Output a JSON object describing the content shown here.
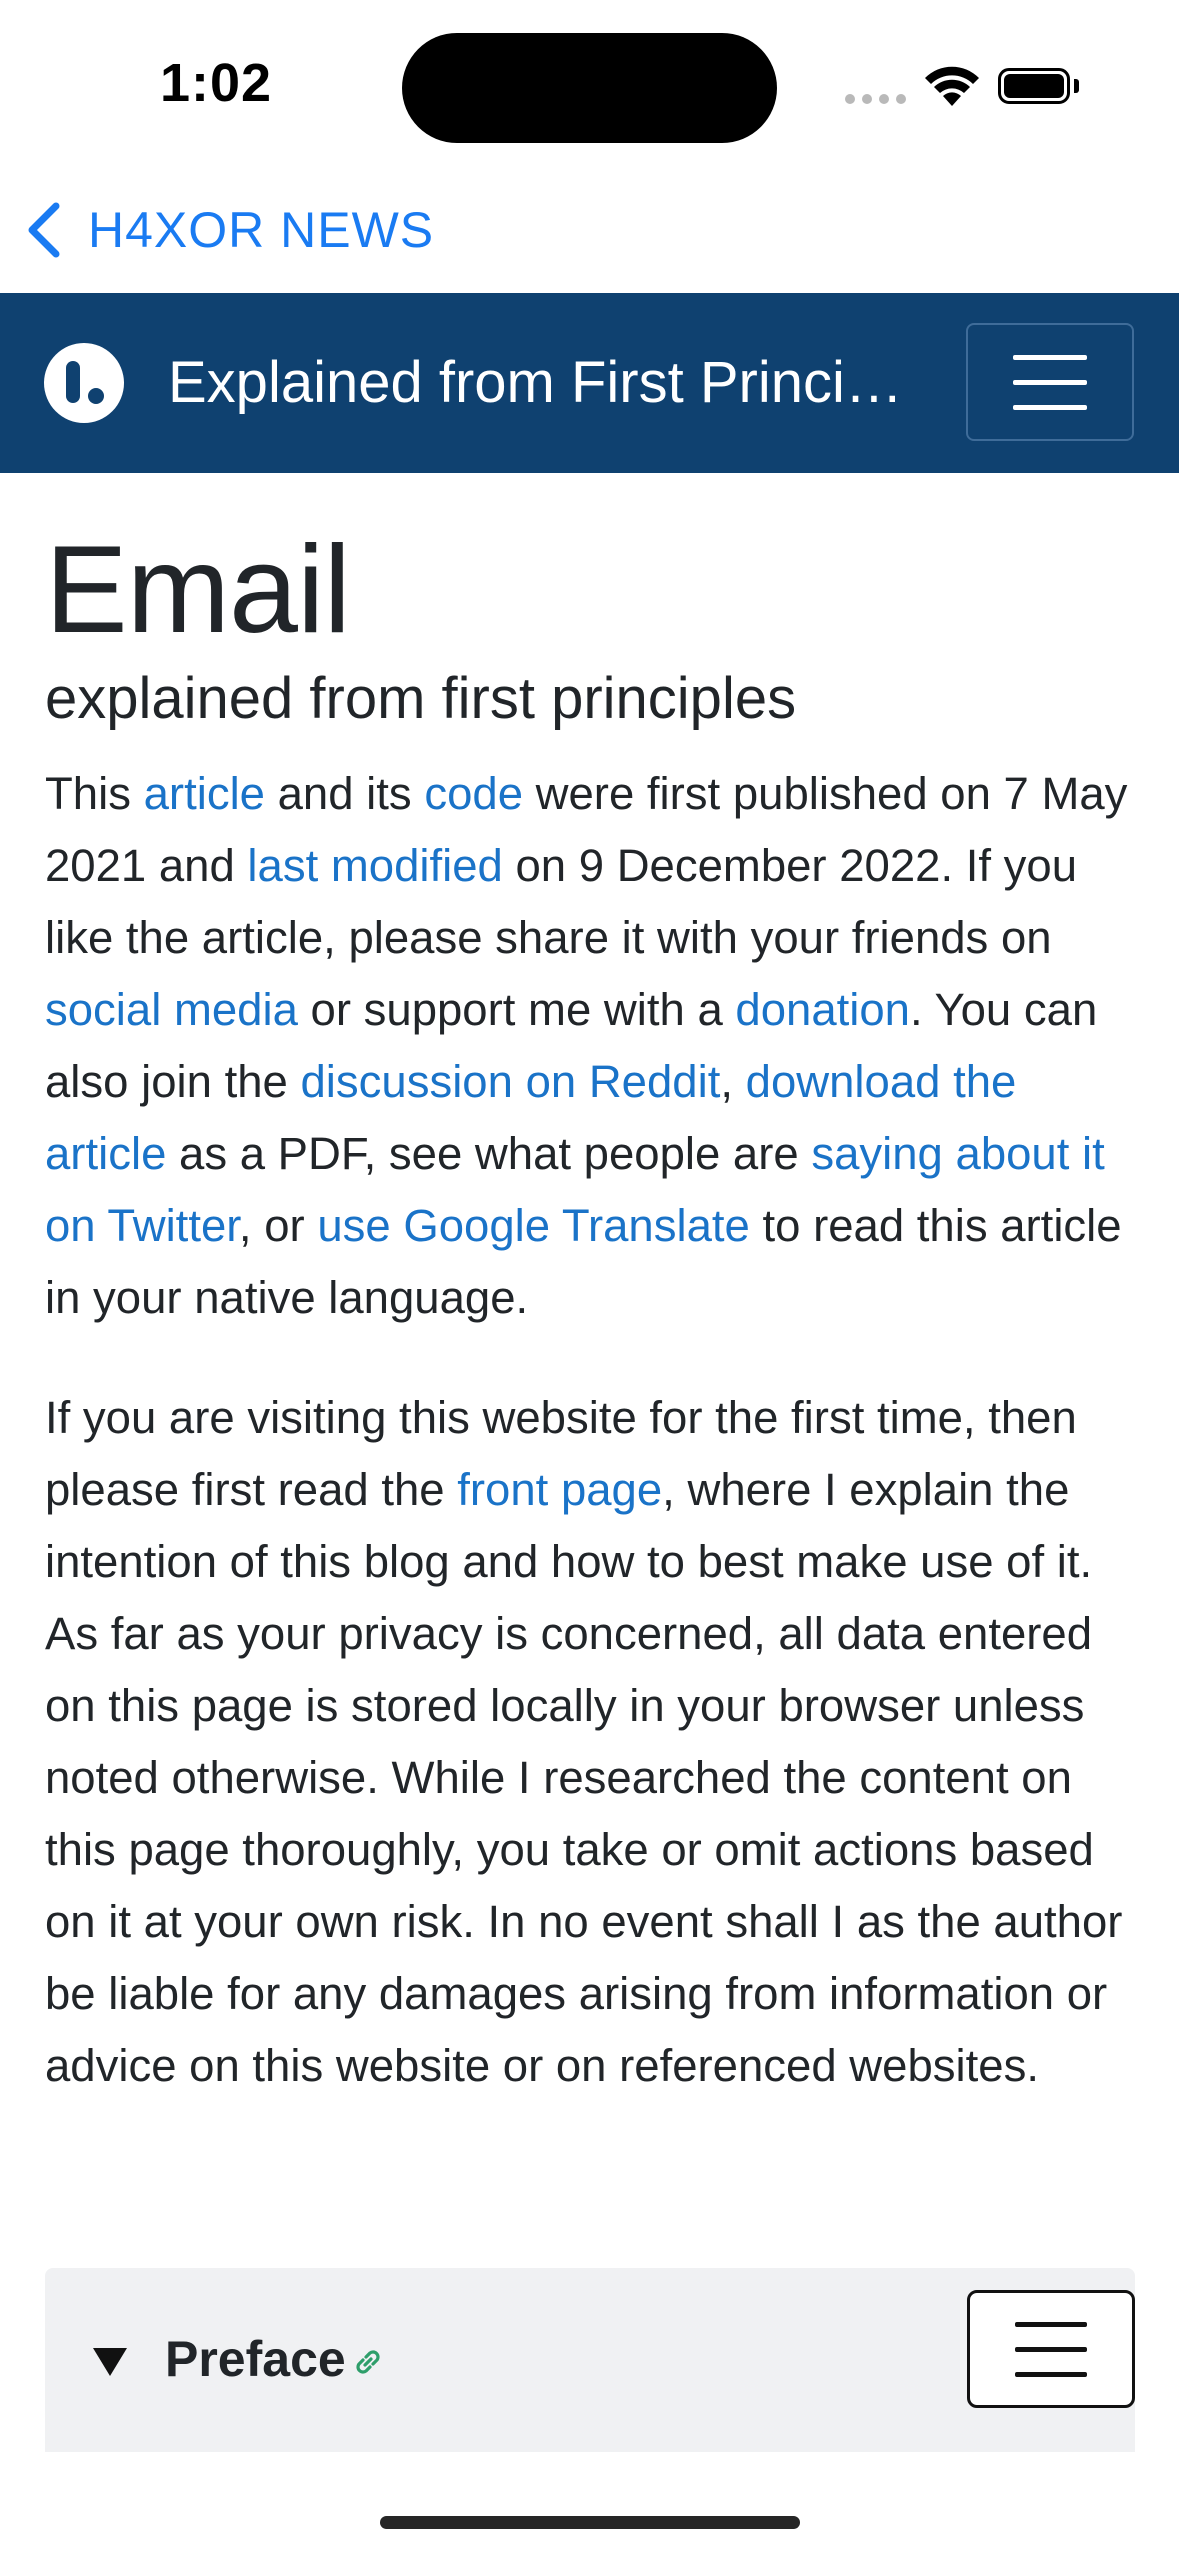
{
  "status_bar": {
    "time": "1:02"
  },
  "nav": {
    "back_label": "H4XOR NEWS"
  },
  "site": {
    "title": "Explained from First Principles",
    "brand_color": "#0f4170"
  },
  "page": {
    "title": "Email",
    "subtitle": "explained from first principles"
  },
  "intro": {
    "t1": "This ",
    "link_article": "article",
    "t2": " and its ",
    "link_code": "code",
    "t3": " were first published on 7 May 2021 and ",
    "link_last_modified": "last modified",
    "t4": " on 9 December 2022. If you like the article, please share it with your friends on ",
    "link_social_media": "social media",
    "t5": " or support me with a ",
    "link_donation": "donation",
    "t6": ". You can also join the ",
    "link_discussion": "discussion on Reddit",
    "t7": ", ",
    "link_download": "download the article",
    "t8": " as a PDF, see what people are ",
    "link_twitter": "saying about it on Twitter",
    "t9": ", or ",
    "link_translate": "use Google Translate",
    "t10": " to read this article in your native language."
  },
  "disclaimer": {
    "t1": "If you are visiting this website for the first time, then please first read the ",
    "link_front_page": "front page",
    "t2": ", where I explain the intention of this blog and how to best make use of it. As far as your privacy is concerned, all data entered on this page is stored locally in your browser unless noted otherwise. While I researched the content on this page thoroughly, you take or omit actions based on it at your own risk. In no event shall I as the author be liable for any damages arising from information or advice on this website or on referenced websites."
  },
  "preface": {
    "label": "Preface"
  },
  "colors": {
    "link": "#1a73c8",
    "ios_blue": "#1a7bf2",
    "anchor_green": "#2e9e6a"
  },
  "icons": [
    "chevron-left-icon",
    "logo-icon",
    "hamburger-menu-icon",
    "disclosure-triangle-icon",
    "link-icon",
    "wifi-icon",
    "battery-icon",
    "signal-icon"
  ]
}
